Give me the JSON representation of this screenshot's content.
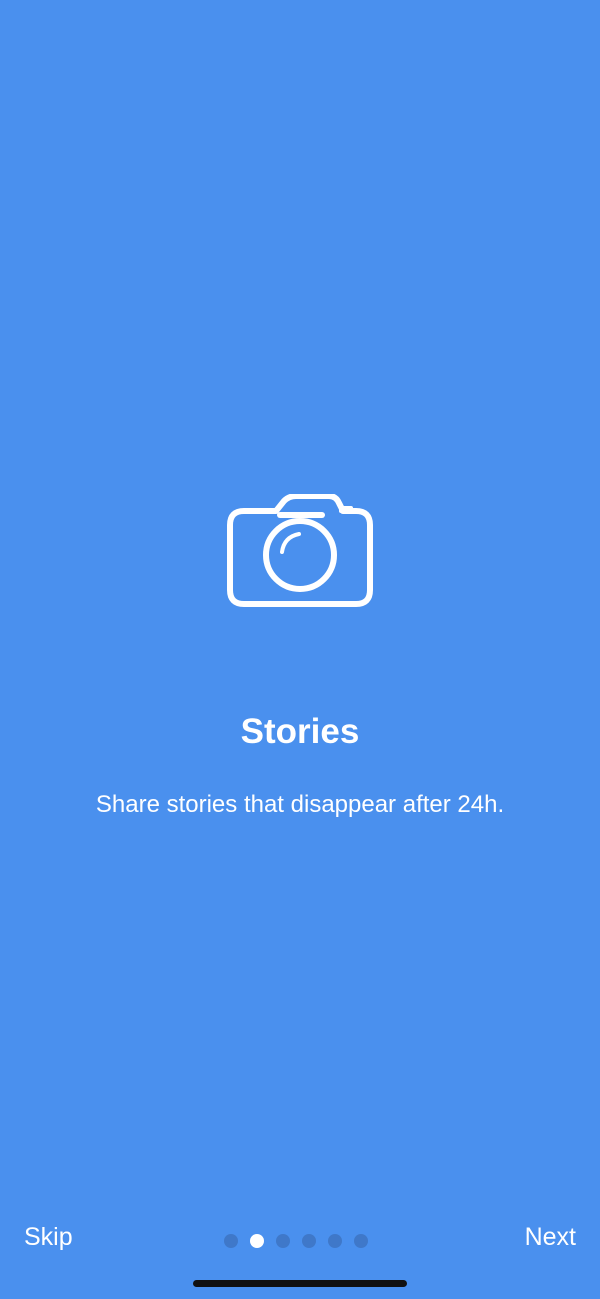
{
  "onboarding": {
    "icon": "camera-icon",
    "title": "Stories",
    "description": "Share stories that disappear after 24h."
  },
  "footer": {
    "skip_label": "Skip",
    "next_label": "Next",
    "page_count": 6,
    "current_page": 2
  },
  "colors": {
    "background": "#4a90ee",
    "text": "#ffffff",
    "active_dot": "#ffffff",
    "inactive_dot": "#3f78c9",
    "home_indicator": "#111111"
  }
}
